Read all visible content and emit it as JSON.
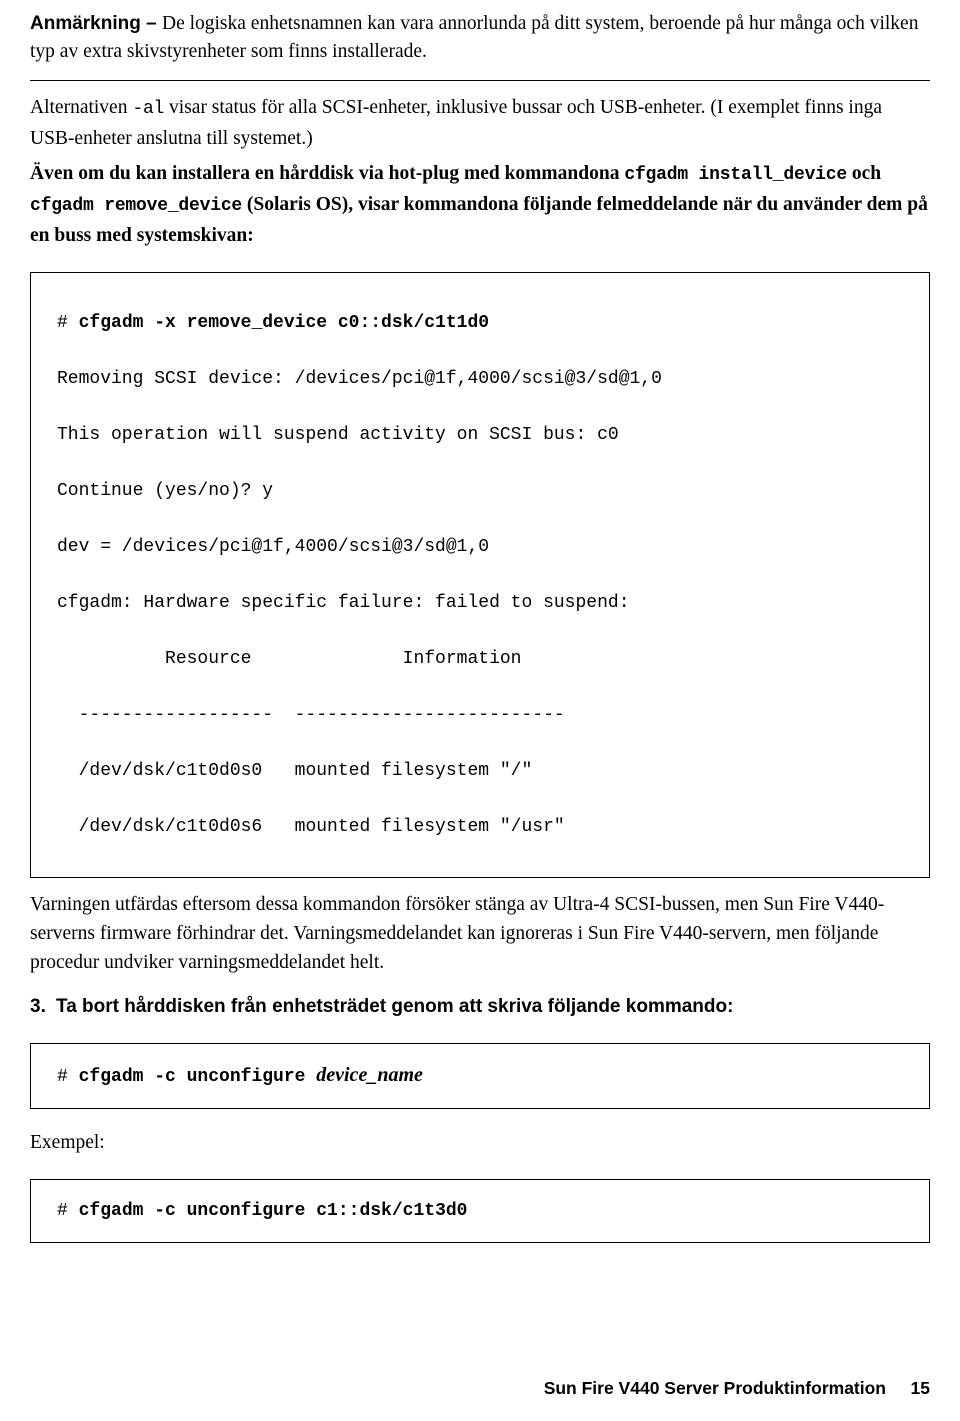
{
  "note": {
    "lead": "Anmärkning – ",
    "text": "De logiska enhetsnamnen kan vara annorlunda på ditt system, beroende på hur många och vilken typ av extra skivstyrenheter som finns installerade."
  },
  "paragraphs": {
    "alternativen": {
      "part1": "Alternativen ",
      "mono1": "-al",
      "part2": " visar status för alla SCSI-enheter, inklusive bussar och USB-enheter. (I exemplet finns inga USB-enheter anslutna till systemet.)"
    },
    "aven": {
      "part1": "Även om du kan installera en hårddisk via hot-plug med kommandona ",
      "mono1": "cfgadm install_device",
      "part2": " och ",
      "mono2": "cfgadm remove_device",
      "part3": " (Solaris OS), visar kommandona följande felmeddelande när du använder dem på en buss med systemskivan:"
    },
    "varning": "Varningen utfärdas eftersom dessa kommandon försöker stänga av Ultra-4 SCSI-bussen, men Sun Fire V440-serverns firmware förhindrar det. Varningsmeddelandet kan ignoreras i Sun Fire V440-servern, men följande procedur undviker varningsmeddelandet helt."
  },
  "code_block_1": {
    "prompt": "# ",
    "command": "cfgadm -x remove_device c0::dsk/c1t1d0",
    "lines": [
      "Removing SCSI device: /devices/pci@1f,4000/scsi@3/sd@1,0",
      "This operation will suspend activity on SCSI bus: c0",
      "Continue (yes/no)? y",
      "dev = /devices/pci@1f,4000/scsi@3/sd@1,0",
      "cfgadm: Hardware specific failure: failed to suspend:",
      "          Resource              Information",
      "  ------------------  -------------------------",
      "  /dev/dsk/c1t0d0s0   mounted filesystem \"/\"",
      "  /dev/dsk/c1t0d0s6   mounted filesystem \"/usr\""
    ]
  },
  "step": {
    "number": "3.",
    "text": "Ta bort hårddisken från enhetsträdet genom att skriva följande kommando:"
  },
  "code_block_2": {
    "prompt": "# ",
    "command": "cfgadm -c unconfigure ",
    "italic_arg": "device_name"
  },
  "exempel_label": "Exempel:",
  "code_block_3": {
    "prompt": "# ",
    "command": "cfgadm -c unconfigure c1::dsk/c1t3d0"
  },
  "footer": {
    "doc_title": "Sun Fire V440 Server Produktinformation",
    "page_number": "15"
  }
}
